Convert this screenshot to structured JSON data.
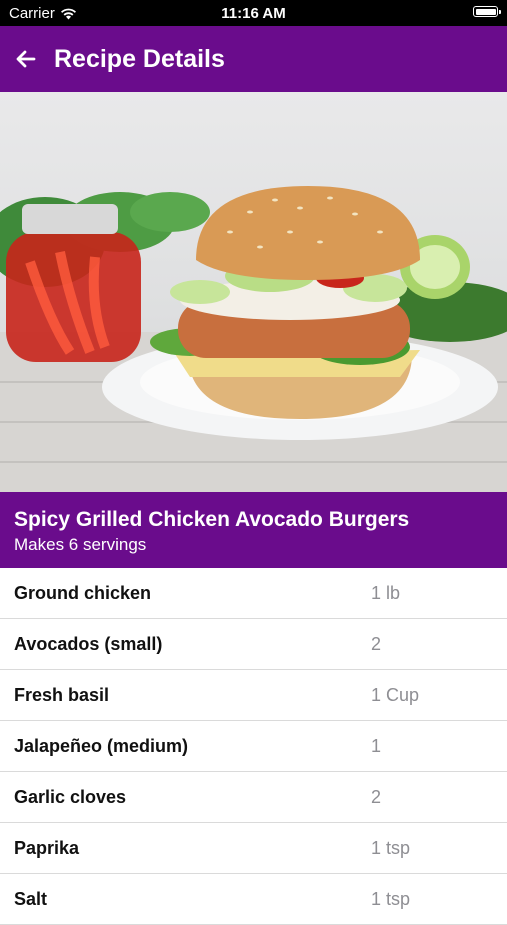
{
  "status_bar": {
    "carrier": "Carrier",
    "time": "11:16 AM"
  },
  "app_bar": {
    "title": "Recipe Details",
    "back_icon": "arrow-left-icon"
  },
  "hero_image": {
    "subject": "chicken-burger-photo"
  },
  "recipe": {
    "name": "Spicy Grilled Chicken Avocado Burgers",
    "servings": "Makes 6 servings"
  },
  "ingredients": [
    {
      "name": "Ground chicken",
      "qty": "1 lb"
    },
    {
      "name": "Avocados (small)",
      "qty": "2"
    },
    {
      "name": "Fresh basil",
      "qty": "1 Cup"
    },
    {
      "name": "Jalapeñeo (medium)",
      "qty": "1"
    },
    {
      "name": "Garlic cloves",
      "qty": "2"
    },
    {
      "name": "Paprika",
      "qty": "1 tsp"
    },
    {
      "name": "Salt",
      "qty": "1 tsp"
    }
  ],
  "colors": {
    "primary": "#6a0c8c",
    "qty_text": "#8e8e93"
  }
}
